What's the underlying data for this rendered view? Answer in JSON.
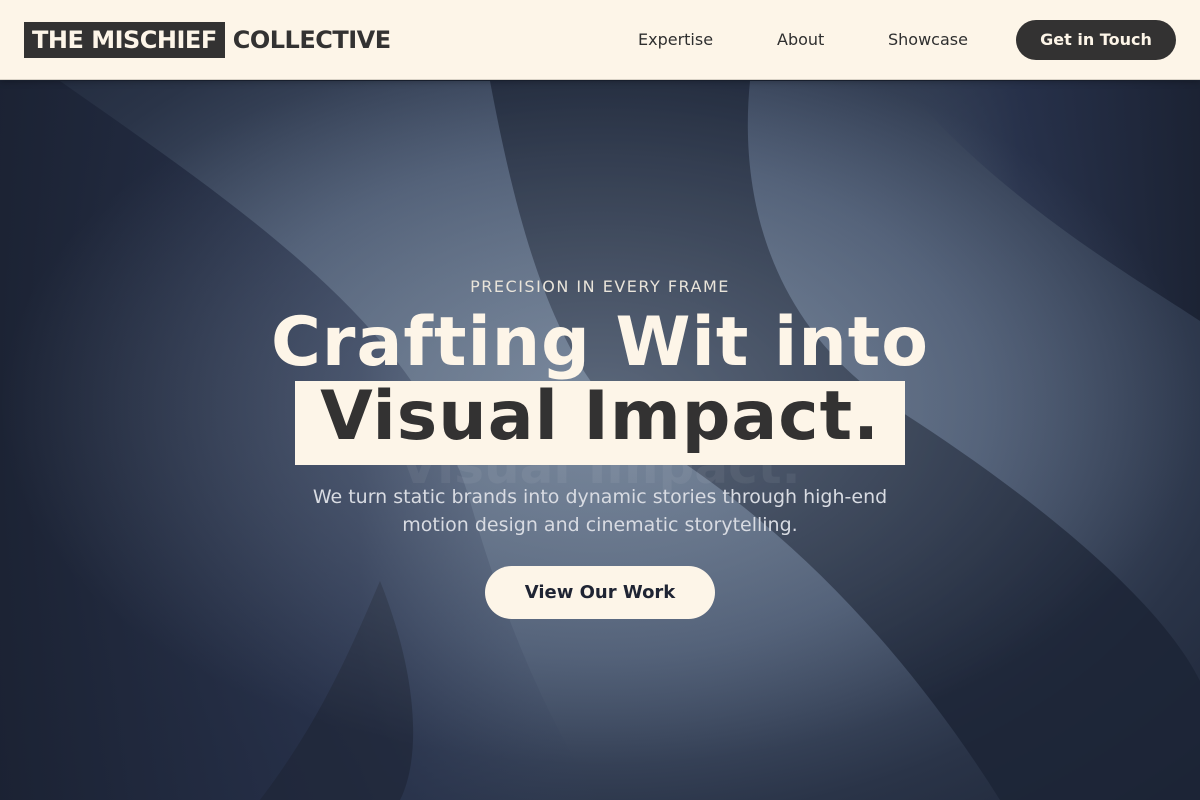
{
  "header": {
    "logo_highlight": "THE MISCHIEF",
    "logo_rest": "COLLECTIVE",
    "nav": [
      "Expertise",
      "About",
      "Showcase"
    ],
    "cta_label": "Get in Touch"
  },
  "hero": {
    "eyebrow": "PRECISION IN EVERY FRAME",
    "headline_line1": "Crafting Wit into",
    "headline_line2": "Visual Impact.",
    "subtitle": "We turn static brands into dynamic stories through high-end motion design and cinematic storytelling.",
    "button_label": "View Our Work"
  },
  "colors": {
    "cream": "#fdf5e8",
    "charcoal": "#333232",
    "hero_dark": "#1e2637"
  }
}
